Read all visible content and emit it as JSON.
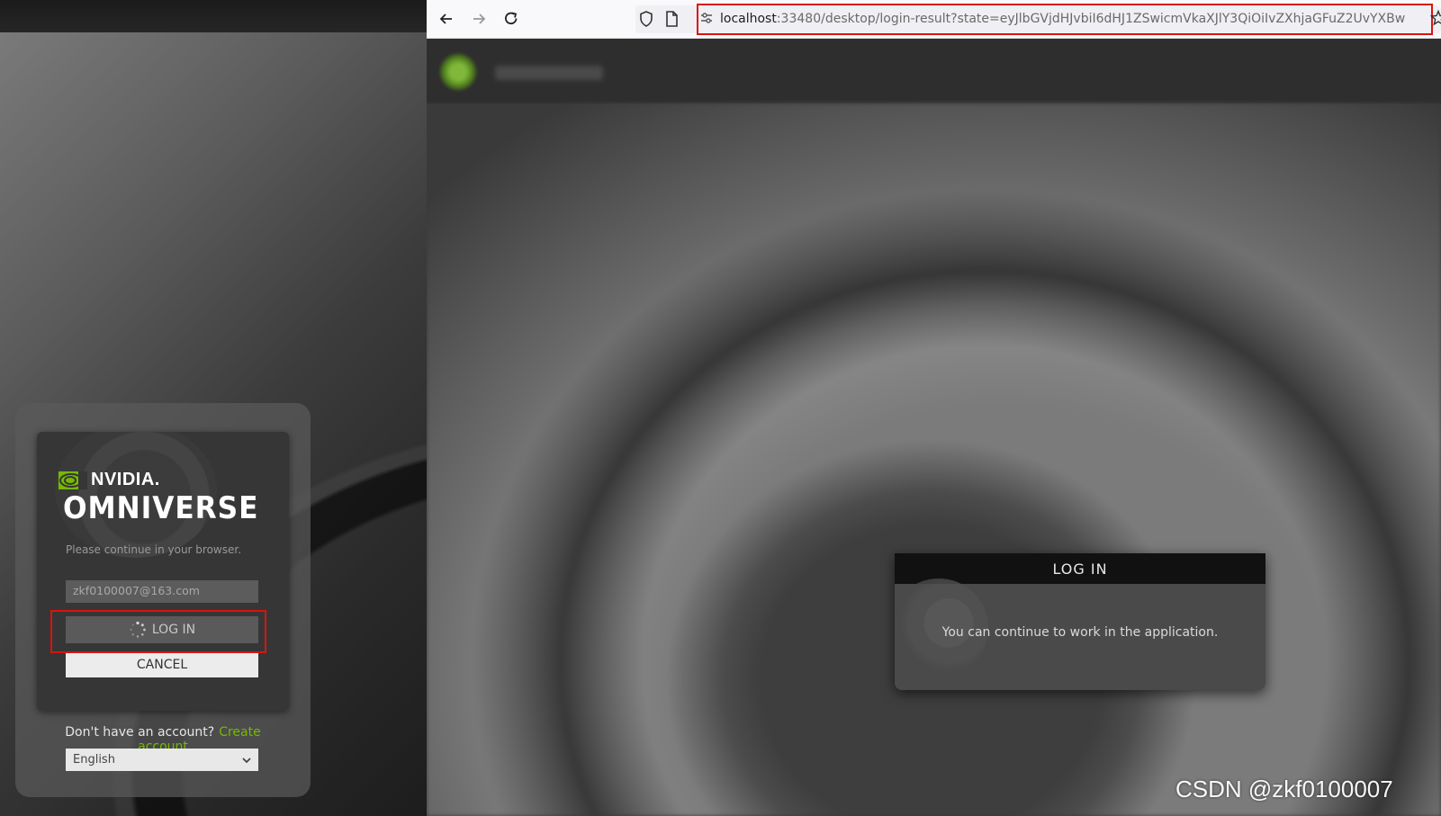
{
  "launcher": {
    "brand": "NVIDIA.",
    "product": "OMNIVERSE",
    "hint": "Please continue in your browser.",
    "email_value": "zkf0100007@163.com",
    "login_label": "LOG IN",
    "cancel_label": "CANCEL",
    "no_account_text": "Don't have an account?",
    "create_account_label": "Create account",
    "language_selected": "English",
    "accent_color": "#76b900",
    "highlight_color": "#d9140e"
  },
  "browser": {
    "url_host": "localhost",
    "url_rest": ":33480/desktop/login-result?state=eyJlbGVjdHJvbiI6dHJ1ZSwicmVkaXJlY3QiOiIvZXhjaGFuZ2UvYXBw",
    "icons": [
      "back-icon",
      "forward-icon",
      "reload-icon",
      "shield-icon",
      "page-icon",
      "permissions-icon",
      "star-icon"
    ]
  },
  "dialog": {
    "title": "LOG IN",
    "message": "You can continue to work in the application."
  },
  "watermark": "CSDN @zkf0100007"
}
